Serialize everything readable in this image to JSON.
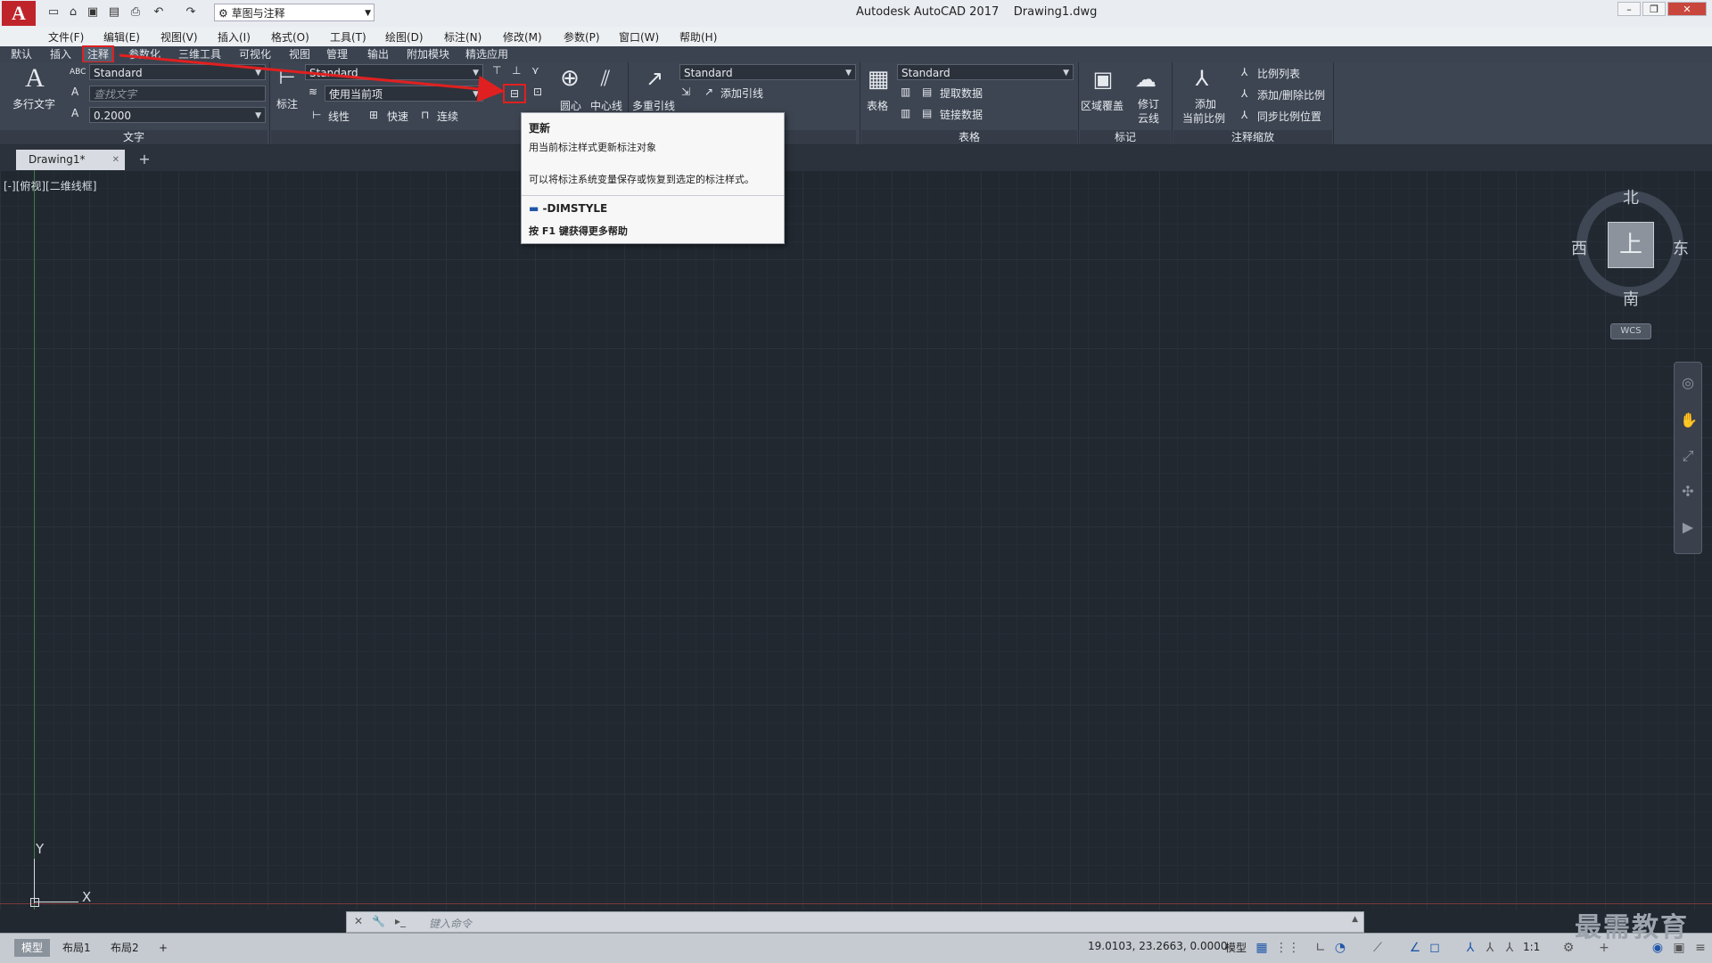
{
  "titlebar": {
    "title": "Autodesk AutoCAD 2017",
    "document": "Drawing1.dwg",
    "workspace": "草图与注释",
    "logo": "A"
  },
  "menu": {
    "items": [
      "文件(F)",
      "编辑(E)",
      "视图(V)",
      "插入(I)",
      "格式(O)",
      "工具(T)",
      "绘图(D)",
      "标注(N)",
      "修改(M)",
      "参数(P)",
      "窗口(W)",
      "帮助(H)"
    ]
  },
  "ribbon_tabs": {
    "items": [
      "默认",
      "插入",
      "注释",
      "参数化",
      "三维工具",
      "可视化",
      "视图",
      "管理",
      "输出",
      "附加模块",
      "精选应用"
    ],
    "active": "注释"
  },
  "ribbon": {
    "text_panel": {
      "mtext_label": "多行文字",
      "style": "Standard",
      "find_placeholder": "查找文字",
      "height": "0.2000",
      "title": "文字"
    },
    "dim_panel": {
      "dim_label": "标注",
      "style": "Standard",
      "layer": "使用当前项",
      "linear": "线性",
      "quick": "快速",
      "continue": "连续",
      "title": "标注"
    },
    "center_panel": {
      "center_mark": "圆心",
      "centerline": "中心线"
    },
    "leader_panel": {
      "multileader": "多重引线",
      "style": "Standard",
      "add_leader": "添加引线"
    },
    "table_panel": {
      "table": "表格",
      "style": "Standard",
      "extract": "提取数据",
      "link": "链接数据",
      "title": "表格"
    },
    "markup_panel": {
      "wipeout": "区域覆盖",
      "revcloud_1": "修订",
      "revcloud_2": "云线",
      "title": "标记"
    },
    "scale_panel": {
      "add_1": "添加",
      "add_2": "当前比例",
      "scale_list": "比例列表",
      "add_delete": "添加/删除比例",
      "sync": "同步比例位置",
      "title": "注释缩放"
    }
  },
  "tooltip": {
    "title": "更新",
    "line1": "用当前标注样式更新标注对象",
    "line2": "可以将标注系统变量保存或恢复到选定的标注样式。",
    "command": "-DIMSTYLE",
    "help": "按 F1 键获得更多帮助"
  },
  "doc_tab": {
    "name": "Drawing1*"
  },
  "viewport": {
    "label": "[-][俯视][二维线框]"
  },
  "viewcube": {
    "north": "北",
    "south": "南",
    "east": "东",
    "west": "西",
    "face": "上",
    "wcs": "WCS"
  },
  "ucs": {
    "x": "X",
    "y": "Y"
  },
  "command": {
    "placeholder": "键入命令"
  },
  "status": {
    "layouts": [
      "模型",
      "布局1",
      "布局2"
    ],
    "coords": "19.0103, 23.2663, 0.0000",
    "space": "模型",
    "scale": "1:1"
  },
  "watermark": "最需教育",
  "colors": {
    "accent_red": "#e02020",
    "ribbon_bg": "#3d4552",
    "canvas_bg": "#212830"
  }
}
